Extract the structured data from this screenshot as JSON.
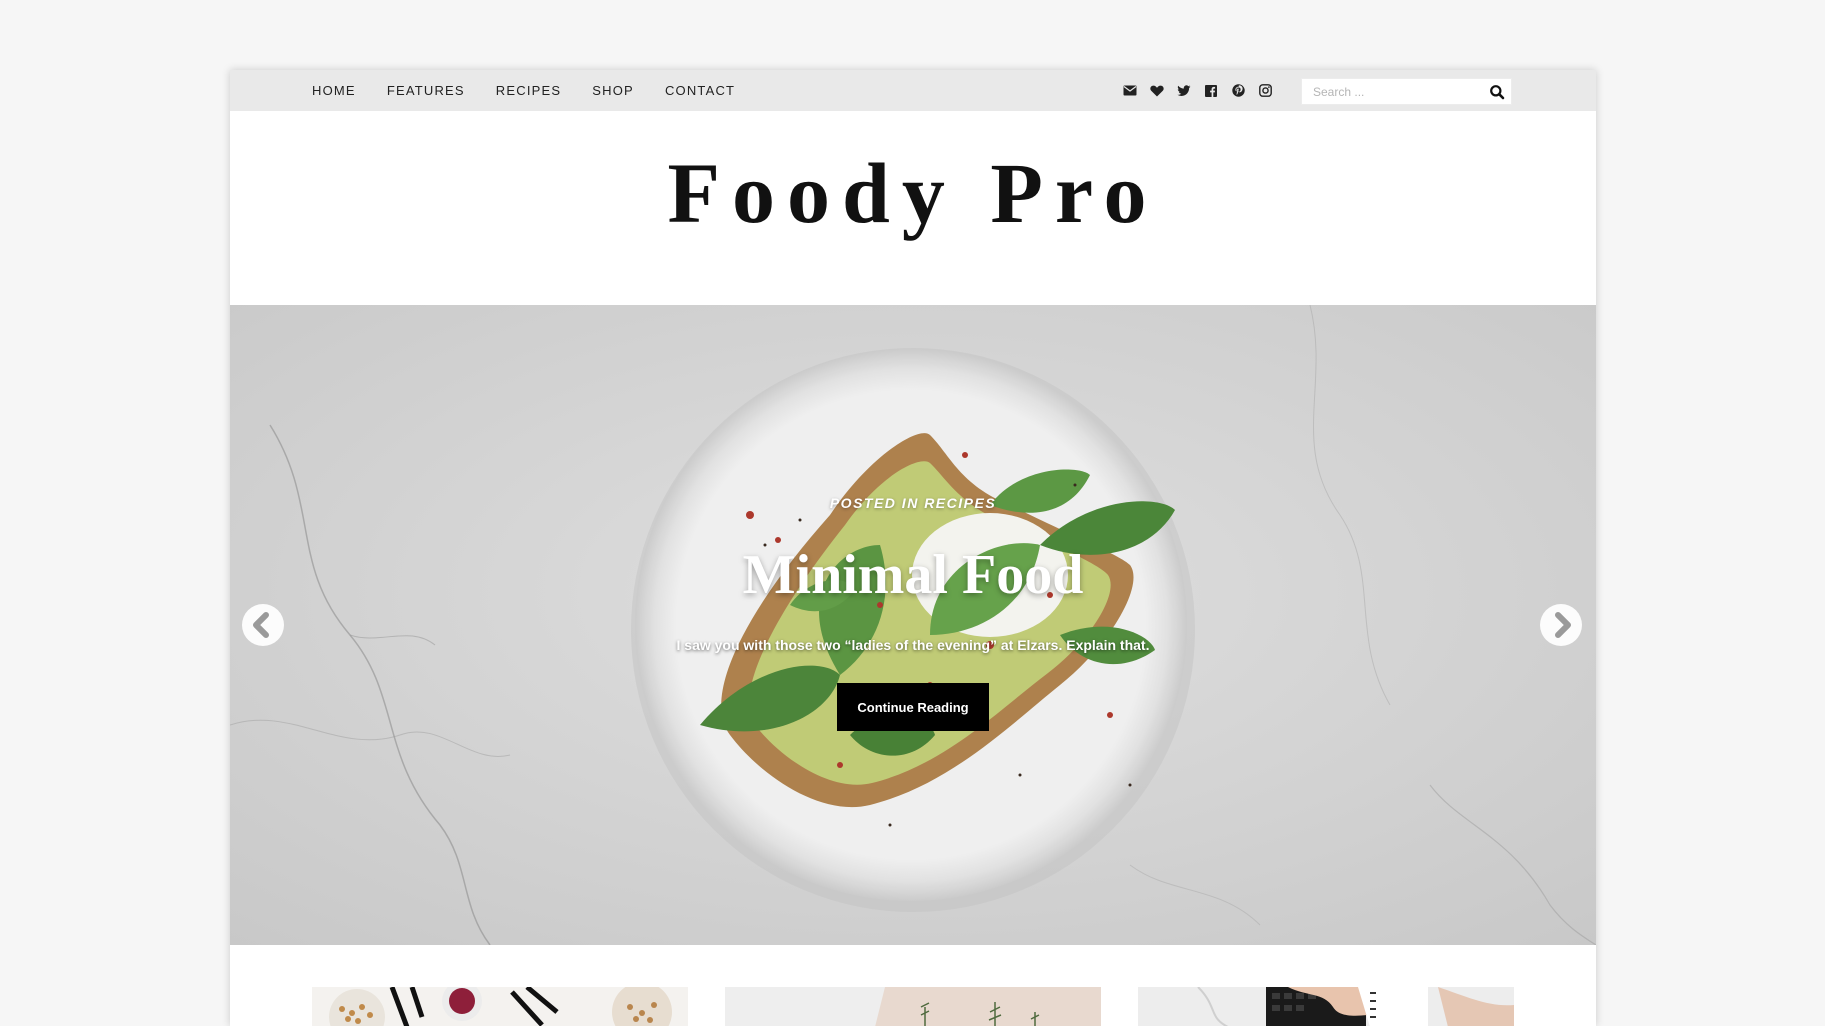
{
  "nav": {
    "items": [
      {
        "label": "HOME"
      },
      {
        "label": "FEATURES"
      },
      {
        "label": "RECIPES"
      },
      {
        "label": "SHOP"
      },
      {
        "label": "CONTACT"
      }
    ]
  },
  "social": {
    "icons": [
      "envelope-icon",
      "heart-icon",
      "twitter-icon",
      "facebook-icon",
      "pinterest-icon",
      "instagram-icon"
    ]
  },
  "search": {
    "placeholder": "Search ...",
    "button_icon": "search-icon"
  },
  "header": {
    "site_title": "Foody Pro"
  },
  "slider": {
    "category": "POSTED IN RECIPES",
    "title": "Minimal Food",
    "excerpt": "I saw you with those two “ladies of the evening” at Elzars. Explain that.",
    "button_label": "Continue Reading",
    "prev_icon": "chevron-left-icon",
    "next_icon": "chevron-right-icon"
  },
  "colors": {
    "topbar": "#e9e9e9",
    "button": "#000000",
    "page_background": "#f6f6f6"
  }
}
